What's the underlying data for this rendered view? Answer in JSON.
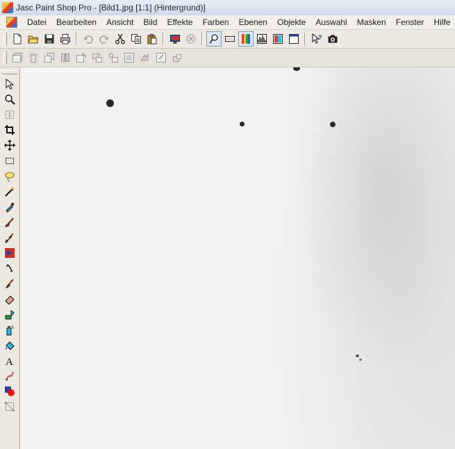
{
  "window": {
    "title": "Jasc Paint Shop Pro - [Bild1.jpg [1:1] (Hintergrund)]"
  },
  "menu": {
    "items": [
      "Datei",
      "Bearbeiten",
      "Ansicht",
      "Bild",
      "Effekte",
      "Farben",
      "Ebenen",
      "Objekte",
      "Auswahl",
      "Masken",
      "Fenster",
      "Hilfe"
    ]
  },
  "toolbar_main": {
    "buttons": [
      "new-icon",
      "open-icon",
      "save-icon",
      "print-icon",
      "undo-icon",
      "redo-icon",
      "cut-icon",
      "copy-icon",
      "paste-icon",
      "full-screen-preview-icon",
      "cancel-icon",
      "overview-icon",
      "tool-options-icon",
      "color-palette-icon",
      "histogram-icon",
      "layer-palette-icon",
      "window-icon",
      "help-pointer-icon",
      "screen-capture-icon"
    ]
  },
  "toolbar_layers": {
    "buttons": [
      "layer-new-icon",
      "layer-delete-icon",
      "layer-duplicate-icon",
      "layer-merge-icon",
      "layer-properties-icon",
      "layer-group-icon",
      "layer-promote-icon",
      "layer-mask-icon",
      "layer-arrange-icon",
      "layer-link-icon",
      "layer-lock-icon"
    ]
  },
  "tools": [
    "arrow-tool-icon",
    "zoom-tool-icon",
    "deformation-tool-icon",
    "crop-tool-icon",
    "move-tool-icon",
    "selection-tool-icon",
    "freehand-selection-icon",
    "magic-wand-icon",
    "dropper-tool-icon",
    "paint-brush-icon",
    "clone-brush-icon",
    "color-replacer-icon",
    "retouch-tool-icon",
    "scratch-remover-icon",
    "eraser-tool-icon",
    "picture-tube-icon",
    "airbrush-icon",
    "flood-fill-icon",
    "text-tool-icon",
    "draw-tool-icon",
    "preset-shapes-icon",
    "object-selector-icon"
  ],
  "colors": {
    "titlebar": "#dde5ef",
    "chrome": "#ece9e2",
    "canvas": "#f2f2f2",
    "speck": "#2a2a2a"
  }
}
